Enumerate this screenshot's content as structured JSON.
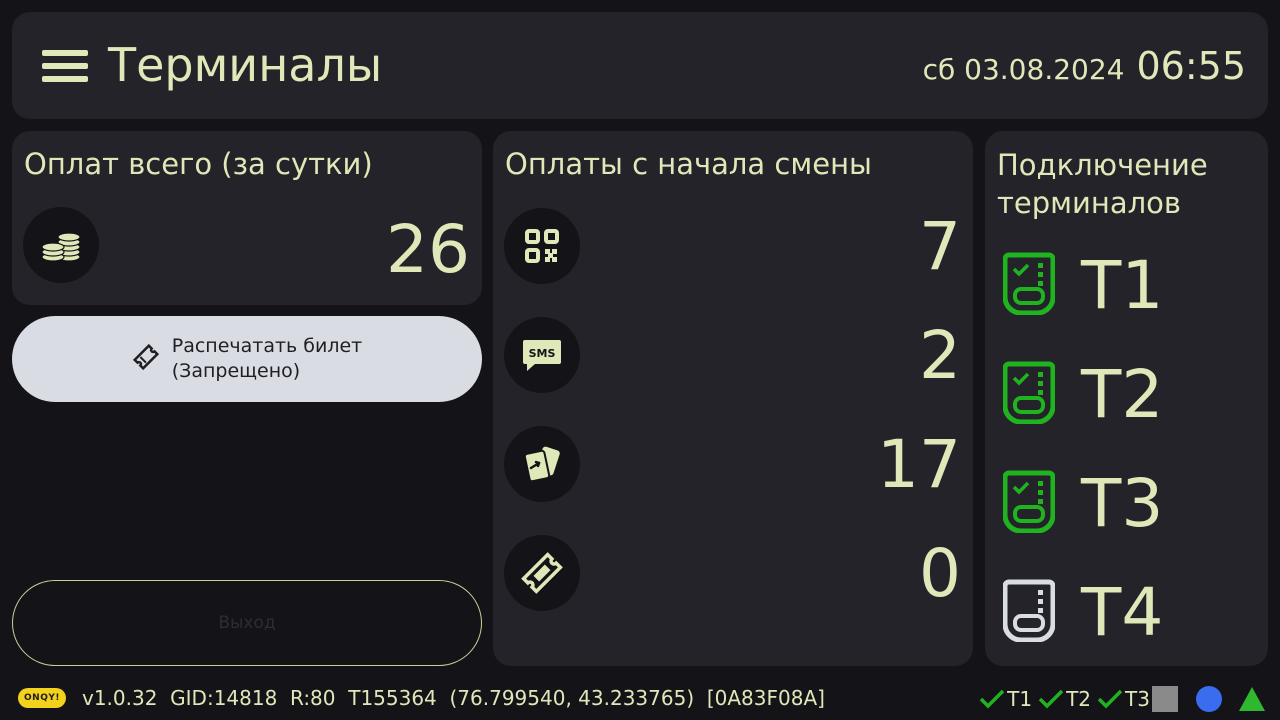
{
  "header": {
    "title": "Терминалы",
    "date": "сб 03.08.2024",
    "time": "06:55"
  },
  "totals": {
    "title": "Оплат всего (за сутки)",
    "value": "26",
    "icon": "coins-icon"
  },
  "print_button": {
    "line1": "Распечатать билет",
    "line2": "(Запрещено)",
    "icon": "ticket-icon"
  },
  "outline_button": {
    "label": "Выход"
  },
  "shift": {
    "title": "Оплаты с начала смены",
    "rows": [
      {
        "icon": "qr-code-icon",
        "value": "7"
      },
      {
        "icon": "sms-icon",
        "value": "2"
      },
      {
        "icon": "cards-icon",
        "value": "17"
      },
      {
        "icon": "ticket-icon",
        "value": "0"
      }
    ]
  },
  "terminals": {
    "title_line1": "Подключение",
    "title_line2": "терминалов",
    "items": [
      {
        "label": "T1",
        "status": "connected"
      },
      {
        "label": "T2",
        "status": "connected"
      },
      {
        "label": "T3",
        "status": "connected"
      },
      {
        "label": "T4",
        "status": "disconnected"
      }
    ]
  },
  "status_bar": {
    "logo": "ONQY!",
    "text": "v1.0.32  GID:14818  R:80  T155364  (76.799540, 43.233765)  [0A83F08A]",
    "indicators": [
      {
        "label": "T1"
      },
      {
        "label": "T2"
      },
      {
        "label": "T3"
      }
    ]
  },
  "colors": {
    "accent": "#dfe8b8",
    "connected": "#1fb31f",
    "disconnected": "#dadce4",
    "card": "#24232a",
    "background": "#141318",
    "status_square": "#8a8a8a",
    "status_circle": "#3a6cf0",
    "status_triangle": "#2fb82f"
  }
}
